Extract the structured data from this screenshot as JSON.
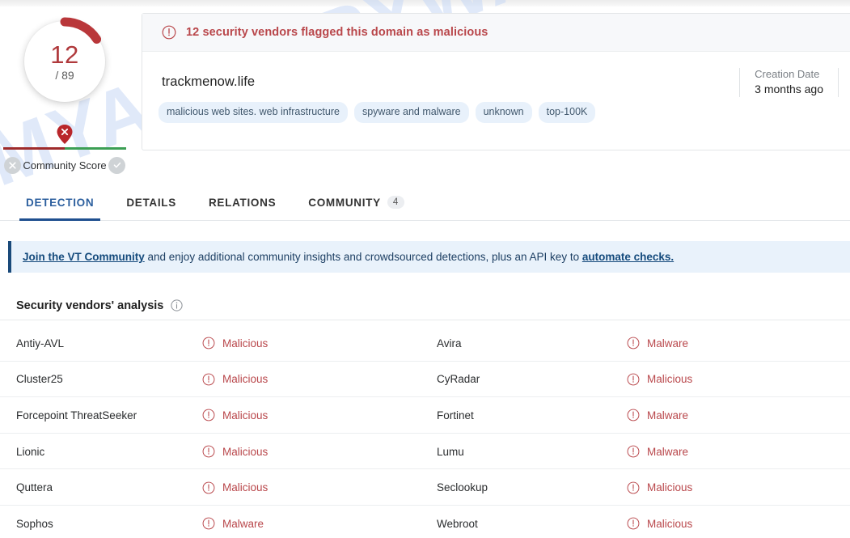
{
  "score": {
    "detections": "12",
    "total": "/ 89",
    "arc_color": "#b9373a",
    "community_score_label": "Community Score",
    "thumbs_down_icon": "x-circle-icon",
    "thumbs_up_icon": "check-circle-icon",
    "pin_icon": "map-pin-x-icon"
  },
  "card": {
    "alert_icon": "alert-circle-icon",
    "alert_text": "12 security vendors flagged this domain as malicious",
    "domain": "trackmenow.life",
    "tags": [
      "malicious web sites. web infrastructure",
      "spyware and malware",
      "unknown",
      "top-100K"
    ],
    "creation_date_label": "Creation Date",
    "creation_date_value": "3 months ago"
  },
  "tabs": [
    {
      "label": "DETECTION",
      "badge": "",
      "active": true
    },
    {
      "label": "DETAILS",
      "badge": "",
      "active": false
    },
    {
      "label": "RELATIONS",
      "badge": "",
      "active": false
    },
    {
      "label": "COMMUNITY",
      "badge": "4",
      "active": false
    }
  ],
  "join_banner": {
    "link1": "Join the VT Community",
    "middle": " and enjoy additional community insights and crowdsourced detections, plus an API key to ",
    "link2": "automate checks."
  },
  "vendors_section": {
    "title": "Security vendors' analysis",
    "info_icon": "info-circle-icon"
  },
  "vendors": {
    "left": [
      {
        "name": "Antiy-AVL",
        "verdict": "Malicious"
      },
      {
        "name": "Cluster25",
        "verdict": "Malicious"
      },
      {
        "name": "Forcepoint ThreatSeeker",
        "verdict": "Malicious"
      },
      {
        "name": "Lionic",
        "verdict": "Malicious"
      },
      {
        "name": "Quttera",
        "verdict": "Malicious"
      },
      {
        "name": "Sophos",
        "verdict": "Malware"
      }
    ],
    "right": [
      {
        "name": "Avira",
        "verdict": "Malware"
      },
      {
        "name": "CyRadar",
        "verdict": "Malicious"
      },
      {
        "name": "Fortinet",
        "verdict": "Malware"
      },
      {
        "name": "Lumu",
        "verdict": "Malware"
      },
      {
        "name": "Seclookup",
        "verdict": "Malicious"
      },
      {
        "name": "Webroot",
        "verdict": "Malicious"
      }
    ]
  },
  "watermark": {
    "text": "MYANTISPYWARE.COM"
  },
  "colors": {
    "malicious_red": "#b9474b",
    "accent_blue": "#1f4f8f",
    "tag_bg": "#e8f1fb",
    "banner_bg": "#e9f2fb"
  }
}
